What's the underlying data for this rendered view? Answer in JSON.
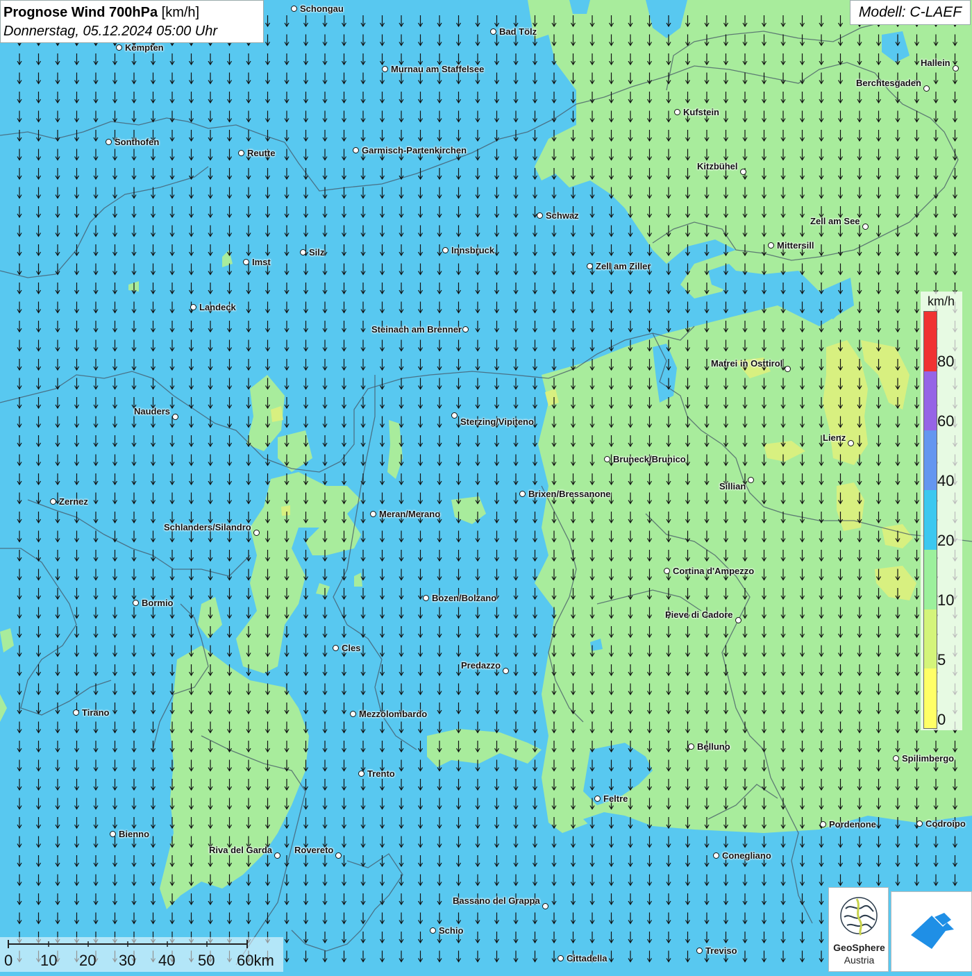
{
  "header": {
    "title_bold": "Prognose Wind 700hPa",
    "title_unit": "[km/h]",
    "datetime": "Donnerstag, 05.12.2024 05:00 Uhr"
  },
  "model": "Modell: C-LAEF",
  "colors": {
    "speed_10_20": "#58c8f0",
    "speed_5_10": "#a8ec9c",
    "speed_0_5": "#d8f080",
    "arrow": "#111111",
    "border_line": "#445566"
  },
  "legend": {
    "unit": "km/h",
    "ticks": [
      "0",
      "5",
      "10",
      "20",
      "40",
      "60",
      "80"
    ],
    "colors": [
      "#ffff66",
      "#d4f47a",
      "#9cf09c",
      "#3cc8f0",
      "#6496f0",
      "#9664e6",
      "#f03232"
    ]
  },
  "scalebar": {
    "labels": [
      "0",
      "10",
      "20",
      "30",
      "40",
      "50",
      "60km"
    ]
  },
  "wind": {
    "direction": "north",
    "arrow_icon": "wind-arrow-icon"
  },
  "logos": {
    "geosphere_line1": "GeoSphere",
    "geosphere_line2": "Austria"
  },
  "cities": [
    {
      "name": "Schongau"
    },
    {
      "name": "Bad Tölz"
    },
    {
      "name": "Kempten"
    },
    {
      "name": "Murnau am Staffelsee"
    },
    {
      "name": "Hallein"
    },
    {
      "name": "Berchtesgaden"
    },
    {
      "name": "Kufstein"
    },
    {
      "name": "Sonthofen"
    },
    {
      "name": "Reutte"
    },
    {
      "name": "Garmisch-Partenkirchen"
    },
    {
      "name": "Kitzbühel"
    },
    {
      "name": "Schwaz"
    },
    {
      "name": "Zell am See"
    },
    {
      "name": "Mittersill"
    },
    {
      "name": "Innsbruck"
    },
    {
      "name": "Silz"
    },
    {
      "name": "Imst"
    },
    {
      "name": "Zell am Ziller"
    },
    {
      "name": "Landeck"
    },
    {
      "name": "Steinach am Brenner"
    },
    {
      "name": "Matrei in Osttirol"
    },
    {
      "name": "Nauders"
    },
    {
      "name": "Sterzing/Vipiteno"
    },
    {
      "name": "Lienz"
    },
    {
      "name": "Bruneck/Brunico"
    },
    {
      "name": "Sillian"
    },
    {
      "name": "Brixen/Bressanone"
    },
    {
      "name": "Zernez"
    },
    {
      "name": "Meran/Merano"
    },
    {
      "name": "Schlanders/Silandro"
    },
    {
      "name": "Cortina d'Ampezzo"
    },
    {
      "name": "Bozen/Bolzano"
    },
    {
      "name": "Bormio"
    },
    {
      "name": "Pieve di Cadore"
    },
    {
      "name": "Cles"
    },
    {
      "name": "Predazzo"
    },
    {
      "name": "Tirano"
    },
    {
      "name": "Mezzolombardo"
    },
    {
      "name": "Belluno"
    },
    {
      "name": "Spilimbergo"
    },
    {
      "name": "Trento"
    },
    {
      "name": "Feltre"
    },
    {
      "name": "Bienno"
    },
    {
      "name": "Pordenone"
    },
    {
      "name": "Codroipo"
    },
    {
      "name": "Riva del Garda"
    },
    {
      "name": "Rovereto"
    },
    {
      "name": "Conegliano"
    },
    {
      "name": "Bassano del Grappa"
    },
    {
      "name": "Schio"
    },
    {
      "name": "Treviso"
    },
    {
      "name": "Cittadella"
    }
  ]
}
